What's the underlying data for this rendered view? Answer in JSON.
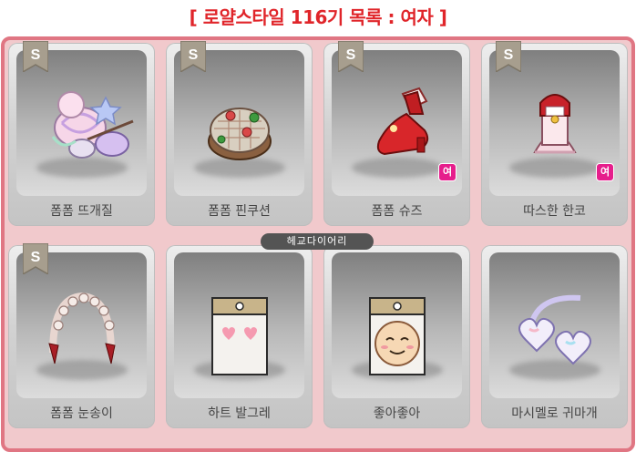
{
  "title": "[ 로얄스타일 116기 목록 : 여자 ]",
  "items": [
    {
      "label": "폼폼 뜨개질",
      "grade_badge": "S",
      "gender_badge": "",
      "icon": "yarn-knitting-icon"
    },
    {
      "label": "폼폼 핀쿠션",
      "grade_badge": "S",
      "gender_badge": "",
      "icon": "pincushion-icon"
    },
    {
      "label": "폼폼 슈즈",
      "grade_badge": "S",
      "gender_badge": "여",
      "icon": "red-shoes-icon"
    },
    {
      "label": "따스한 한코",
      "grade_badge": "S",
      "gender_badge": "여",
      "icon": "winter-coat-icon"
    },
    {
      "label": "폼폼 눈송이",
      "grade_badge": "S",
      "gender_badge": "",
      "icon": "pearl-ring-icon"
    },
    {
      "label": "하트 발그레",
      "grade_badge": "",
      "gender_badge": "",
      "icon": "heart-blush-icon"
    },
    {
      "label": "좋아좋아",
      "grade_badge": "",
      "gender_badge": "",
      "icon": "happy-face-icon"
    },
    {
      "label": "마시멜로 귀마개",
      "grade_badge": "",
      "gender_badge": "",
      "icon": "earmuffs-icon"
    }
  ],
  "watermark": "헤교다이어리",
  "colors": {
    "title": "#e0252a",
    "frame_border": "#e07683",
    "gender_badge": "#e61e8c"
  }
}
